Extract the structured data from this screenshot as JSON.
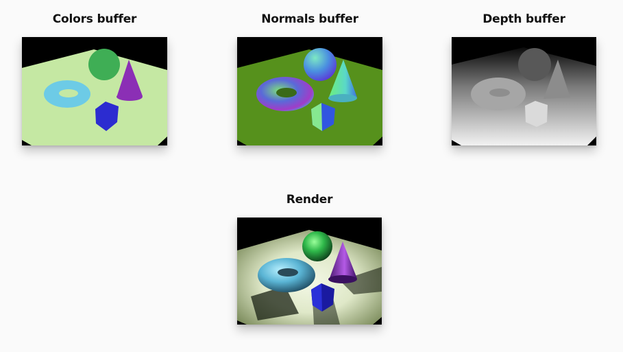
{
  "panels": {
    "colors": {
      "title": "Colors buffer"
    },
    "normals": {
      "title": "Normals buffer"
    },
    "depth": {
      "title": "Depth buffer"
    },
    "render": {
      "title": "Render"
    }
  }
}
